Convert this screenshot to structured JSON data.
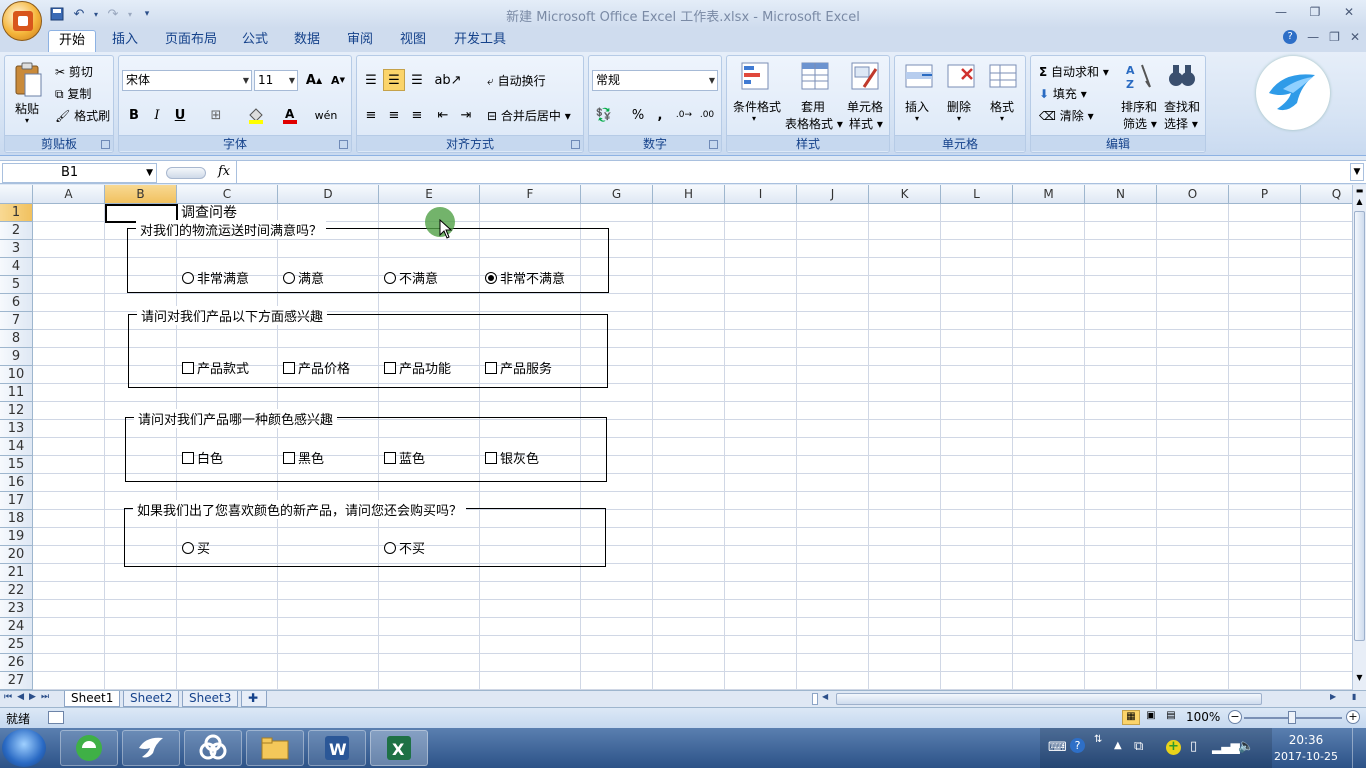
{
  "window": {
    "title": "新建 Microsoft Office Excel 工作表.xlsx - Microsoft Excel"
  },
  "ribbon": {
    "tabs": [
      "开始",
      "插入",
      "页面布局",
      "公式",
      "数据",
      "审阅",
      "视图",
      "开发工具"
    ],
    "clipboard": {
      "paste": "粘贴",
      "cut": "剪切",
      "copy": "复制",
      "format_painter": "格式刷",
      "label": "剪贴板"
    },
    "font": {
      "name": "宋体",
      "size": "11",
      "label": "字体"
    },
    "alignment": {
      "wrap": "自动换行",
      "merge": "合并后居中",
      "label": "对齐方式"
    },
    "number": {
      "format": "常规",
      "label": "数字"
    },
    "styles": {
      "conditional": "条件格式",
      "table_line1": "套用",
      "table_line2": "表格格式",
      "cell_line1": "单元格",
      "cell_line2": "样式",
      "label": "样式"
    },
    "cells": {
      "insert": "插入",
      "delete": "删除",
      "format": "格式",
      "label": "单元格"
    },
    "editing": {
      "autosum": "自动求和",
      "fill": "填充",
      "clear": "清除",
      "sort_line1": "排序和",
      "sort_line2": "筛选",
      "find_line1": "查找和",
      "find_line2": "选择",
      "label": "编辑"
    }
  },
  "formula_bar": {
    "name_box": "B1",
    "fx": "fx",
    "formula": ""
  },
  "grid": {
    "columns": [
      "A",
      "B",
      "C",
      "D",
      "E",
      "F",
      "G",
      "H",
      "I",
      "J",
      "K",
      "L",
      "M",
      "N",
      "O",
      "P",
      "Q"
    ],
    "rows": [
      "1",
      "2",
      "3",
      "4",
      "5",
      "6",
      "7",
      "8",
      "9",
      "10",
      "11",
      "12",
      "13",
      "14",
      "15",
      "16",
      "17",
      "18",
      "19",
      "20",
      "21",
      "22",
      "23",
      "24",
      "25",
      "26",
      "27"
    ]
  },
  "survey": {
    "title": "调查问卷",
    "q1": {
      "label": "对我们的物流运送时间满意吗？",
      "options": [
        "非常满意",
        "满意",
        "不满意",
        "非常不满意"
      ],
      "selected": 3
    },
    "q2": {
      "label": "请问对我们产品以下方面感兴趣",
      "options": [
        "产品款式",
        "产品价格",
        "产品功能",
        "产品服务"
      ]
    },
    "q3": {
      "label": "请问对我们产品哪一种颜色感兴趣",
      "options": [
        "白色",
        "黑色",
        "蓝色",
        "银灰色"
      ]
    },
    "q4": {
      "label": "如果我们出了您喜欢颜色的新产品，请问您还会购买吗？",
      "options": [
        "买",
        "不买"
      ]
    }
  },
  "sheets": [
    "Sheet1",
    "Sheet2",
    "Sheet3"
  ],
  "status": {
    "ready": "就绪",
    "zoom": "100%"
  },
  "taskbar": {
    "time": "20:36",
    "date": "2017-10-25"
  }
}
